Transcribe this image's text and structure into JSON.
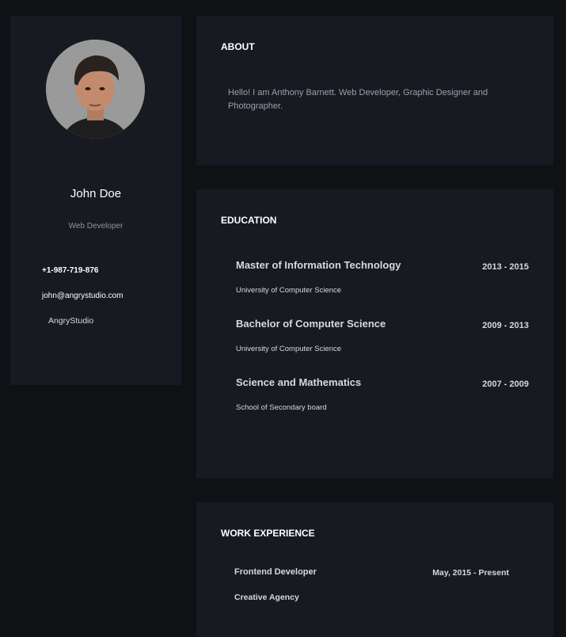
{
  "profile": {
    "name": "John Doe",
    "title": "Web Developer",
    "phone": "+1-987-719-876",
    "email": "john@angrystudio.com",
    "company": "AngryStudio"
  },
  "about": {
    "heading": "ABOUT",
    "text": "Hello! I am Anthony Barnett. Web Developer, Graphic Designer and Photographer."
  },
  "education": {
    "heading": "EDUCATION",
    "items": [
      {
        "degree": "Master of Information Technology",
        "years": "2013 - 2015",
        "school": "University of Computer Science"
      },
      {
        "degree": "Bachelor of Computer Science",
        "years": "2009 - 2013",
        "school": "University of Computer Science"
      },
      {
        "degree": "Science and Mathematics",
        "years": "2007 - 2009",
        "school": "School of Secondary board"
      }
    ]
  },
  "work": {
    "heading": "WORK EXPERIENCE",
    "items": [
      {
        "role": "Frontend Developer",
        "dates": "May, 2015 - Present",
        "company": "Creative Agency"
      }
    ]
  }
}
